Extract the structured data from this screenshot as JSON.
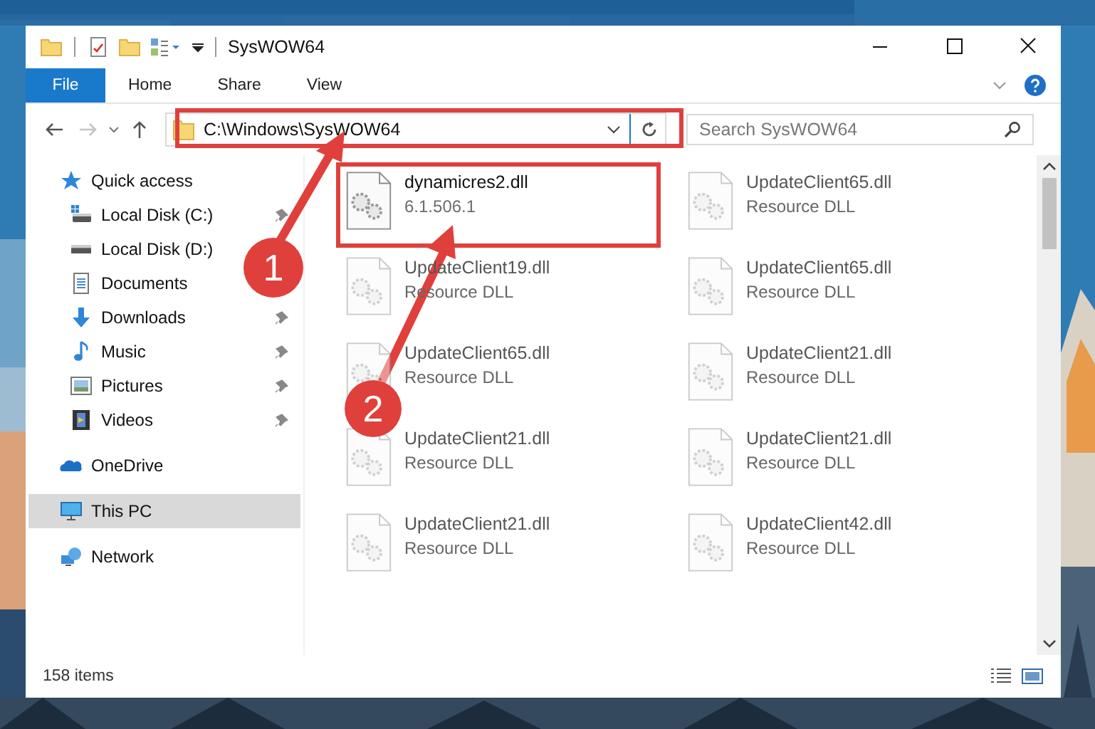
{
  "window": {
    "title": "SysWOW64"
  },
  "ribbon_tabs": [
    {
      "label": "File",
      "kind": "file"
    },
    {
      "label": "Home",
      "kind": "tab"
    },
    {
      "label": "Share",
      "kind": "tab"
    },
    {
      "label": "View",
      "kind": "tab"
    }
  ],
  "address_bar": {
    "path": "C:\\Windows\\SysWOW64"
  },
  "search": {
    "placeholder": "Search SysWOW64"
  },
  "sidebar": {
    "items": [
      {
        "label": "Quick access",
        "pinned": false,
        "selected": false
      },
      {
        "label": "Local Disk (C:)",
        "pinned": true,
        "selected": false
      },
      {
        "label": "Local Disk (D:)",
        "pinned": false,
        "selected": false
      },
      {
        "label": "Documents",
        "pinned": false,
        "selected": false
      },
      {
        "label": "Downloads",
        "pinned": true,
        "selected": false
      },
      {
        "label": "Music",
        "pinned": true,
        "selected": false
      },
      {
        "label": "Pictures",
        "pinned": true,
        "selected": false
      },
      {
        "label": "Videos",
        "pinned": true,
        "selected": false
      },
      {
        "label": "OneDrive",
        "pinned": false,
        "selected": false
      },
      {
        "label": "This PC",
        "pinned": false,
        "selected": true
      },
      {
        "label": "Network",
        "pinned": false,
        "selected": false
      }
    ]
  },
  "files": [
    {
      "name": "dynamicres2.dll",
      "detail": "6.1.506.1",
      "blurred": false
    },
    {
      "name": "UpdateClient65.dll",
      "detail": "Resource DLL",
      "blurred": true
    },
    {
      "name": "UpdateClient19.dll",
      "detail": "Resource DLL",
      "blurred": true
    },
    {
      "name": "UpdateClient65.dll",
      "detail": "Resource DLL",
      "blurred": true
    },
    {
      "name": "UpdateClient65.dll",
      "detail": "Resource DLL",
      "blurred": true
    },
    {
      "name": "UpdateClient21.dll",
      "detail": "Resource DLL",
      "blurred": true
    },
    {
      "name": "UpdateClient21.dll",
      "detail": "Resource DLL",
      "blurred": true
    },
    {
      "name": "UpdateClient21.dll",
      "detail": "Resource DLL",
      "blurred": true
    },
    {
      "name": "UpdateClient21.dll",
      "detail": "Resource DLL",
      "blurred": true
    },
    {
      "name": "UpdateClient42.dll",
      "detail": "Resource DLL",
      "blurred": true
    }
  ],
  "status_bar": {
    "item_count": "158 items"
  },
  "annotations": [
    {
      "label": "1",
      "color": "#e0403c"
    },
    {
      "label": "2",
      "color": "#e0403c"
    }
  ]
}
